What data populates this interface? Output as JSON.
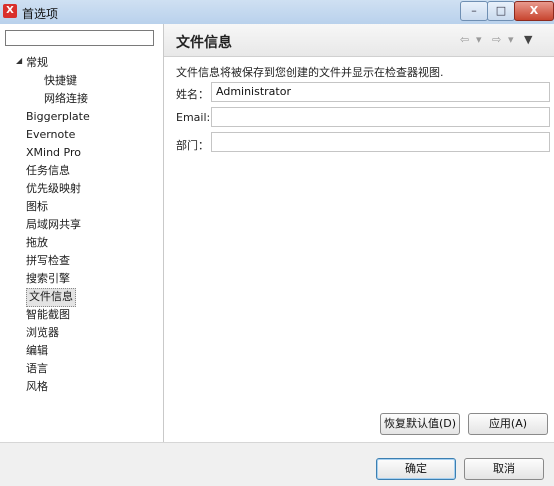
{
  "window": {
    "title": "首选项",
    "app_icon_glyph": "X",
    "controls": {
      "minimize": "–",
      "maximize": "□",
      "close": "X"
    }
  },
  "sidebar": {
    "filter_value": "",
    "toggle_glyph": "◢",
    "items": [
      {
        "label": "常规",
        "level": 0,
        "selected": false
      },
      {
        "label": "快捷键",
        "level": 1,
        "selected": false
      },
      {
        "label": "网络连接",
        "level": 1,
        "selected": false
      },
      {
        "label": "Biggerplate",
        "level": 0,
        "selected": false
      },
      {
        "label": "Evernote",
        "level": 0,
        "selected": false
      },
      {
        "label": "XMind Pro",
        "level": 0,
        "selected": false
      },
      {
        "label": "任务信息",
        "level": 0,
        "selected": false
      },
      {
        "label": "优先级映射",
        "level": 0,
        "selected": false
      },
      {
        "label": "图标",
        "level": 0,
        "selected": false
      },
      {
        "label": "局域网共享",
        "level": 0,
        "selected": false
      },
      {
        "label": "拖放",
        "level": 0,
        "selected": false
      },
      {
        "label": "拼写检查",
        "level": 0,
        "selected": false
      },
      {
        "label": "搜索引擎",
        "level": 0,
        "selected": false
      },
      {
        "label": "文件信息",
        "level": 0,
        "selected": true
      },
      {
        "label": "智能截图",
        "level": 0,
        "selected": false
      },
      {
        "label": "浏览器",
        "level": 0,
        "selected": false
      },
      {
        "label": "编辑",
        "level": 0,
        "selected": false
      },
      {
        "label": "语言",
        "level": 0,
        "selected": false
      },
      {
        "label": "风格",
        "level": 0,
        "selected": false
      }
    ]
  },
  "main": {
    "title": "文件信息",
    "nav": {
      "back": "⇦",
      "back_menu": "▾",
      "forward": "⇨",
      "forward_menu": "▾",
      "view_menu": "▼"
    },
    "description": "文件信息将被保存到您创建的文件并显示在检查器视图.",
    "fields": [
      {
        "label": "姓名：",
        "value": "Administrator"
      },
      {
        "label": "Email:",
        "value": ""
      },
      {
        "label": "部门：",
        "value": ""
      }
    ],
    "restore_defaults_label": "恢复默认值(D)",
    "apply_label": "应用(A)"
  },
  "footer": {
    "ok_label": "确定",
    "cancel_label": "取消"
  },
  "colors": {
    "close_button": "#c8452f",
    "app_icon": "#d9302c",
    "selected_item_bg": "#e4e4e4"
  }
}
